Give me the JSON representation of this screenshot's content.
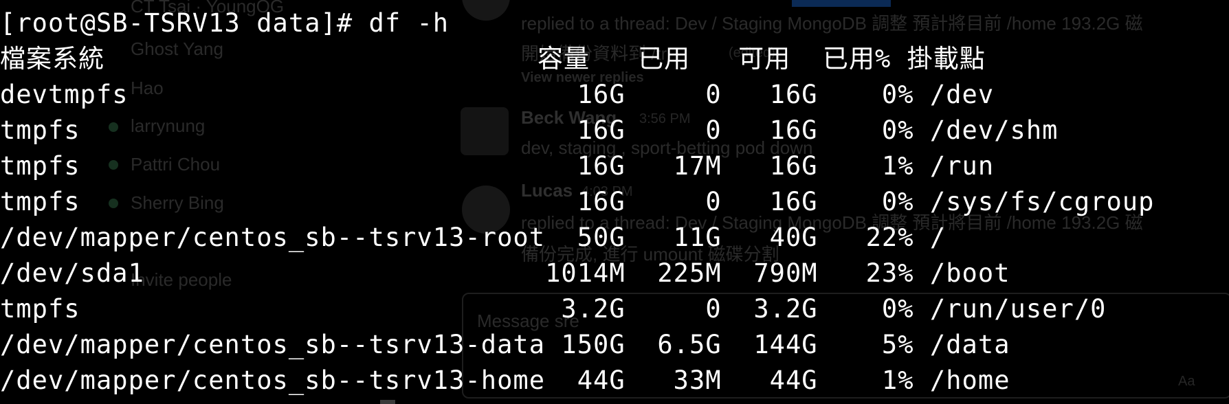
{
  "background_app": {
    "channel_members": [
      "CT Tsai · YoungOG",
      "Ghost Yang",
      "Hao",
      "larrynung",
      "Pattri Chou",
      "Sherry Bing",
      "Invite people"
    ],
    "thread_reply_1": "replied to a thread: Dev / Staging MongoDB 調整 預計將目前 /home 193.2G 磁",
    "thread_reply_1_line2": "開始備份資料到 /tr",
    "edited_tag": "(edited)",
    "view_newer": "View newer replies",
    "msg_author_1": "Beck Wang",
    "msg_time_1": "3:56 PM",
    "msg_text_1": "dev, staging , sport-betting pod down",
    "msg_author_2": "Lucas",
    "msg_time_2": "4:03 PM",
    "thread_reply_2": "replied to a thread: Dev / Staging MongoDB 調整 預計將目前 /home 193.2G 磁",
    "thread_reply_2_line2": "備份完成, 進行 umount 磁碟分割",
    "composer_placeholder": "Message sre",
    "composer_aa": "Aa"
  },
  "terminal": {
    "prompt": "[root@SB-TSRV13 data]# df -h",
    "header": "檔案系統                           容量   已用   可用  已用% 掛載點",
    "rows": [
      "devtmpfs                            16G     0   16G    0% /dev",
      "tmpfs                               16G     0   16G    0% /dev/shm",
      "tmpfs                               16G   17M   16G    1% /run",
      "tmpfs                               16G     0   16G    0% /sys/fs/cgroup",
      "/dev/mapper/centos_sb--tsrv13-root  50G   11G   40G   22% /",
      "/dev/sda1                         1014M  225M  790M   23% /boot",
      "tmpfs                              3.2G     0  3.2G    0% /run/user/0",
      "/dev/mapper/centos_sb--tsrv13-data 150G  6.5G  144G    5% /data",
      "/dev/mapper/centos_sb--tsrv13-home  44G   33M   44G    1% /home"
    ]
  }
}
